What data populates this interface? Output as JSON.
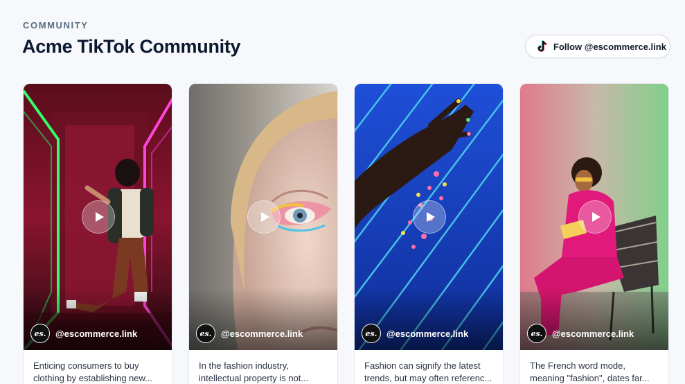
{
  "header": {
    "eyebrow": "COMMUNITY",
    "title": "Acme TikTok Community",
    "follow_label": "Follow @escommerce.link"
  },
  "cards": [
    {
      "handle": "@escommerce.link",
      "avatar_text": "es.",
      "caption_line1": "Enticing consumers to buy",
      "caption_line2": "clothing by establishing new..."
    },
    {
      "handle": "@escommerce.link",
      "avatar_text": "es.",
      "caption_line1": "In the fashion industry,",
      "caption_line2": "intellectual property is not..."
    },
    {
      "handle": "@escommerce.link",
      "avatar_text": "es.",
      "caption_line1": "Fashion can signify the latest",
      "caption_line2": "trends, but may often referenc..."
    },
    {
      "handle": "@escommerce.link",
      "avatar_text": "es.",
      "caption_line1": "The French word mode,",
      "caption_line2": "meaning \"fashion\", dates far..."
    }
  ],
  "icons": {
    "follow": "tiktok-icon",
    "play": "play-icon"
  }
}
